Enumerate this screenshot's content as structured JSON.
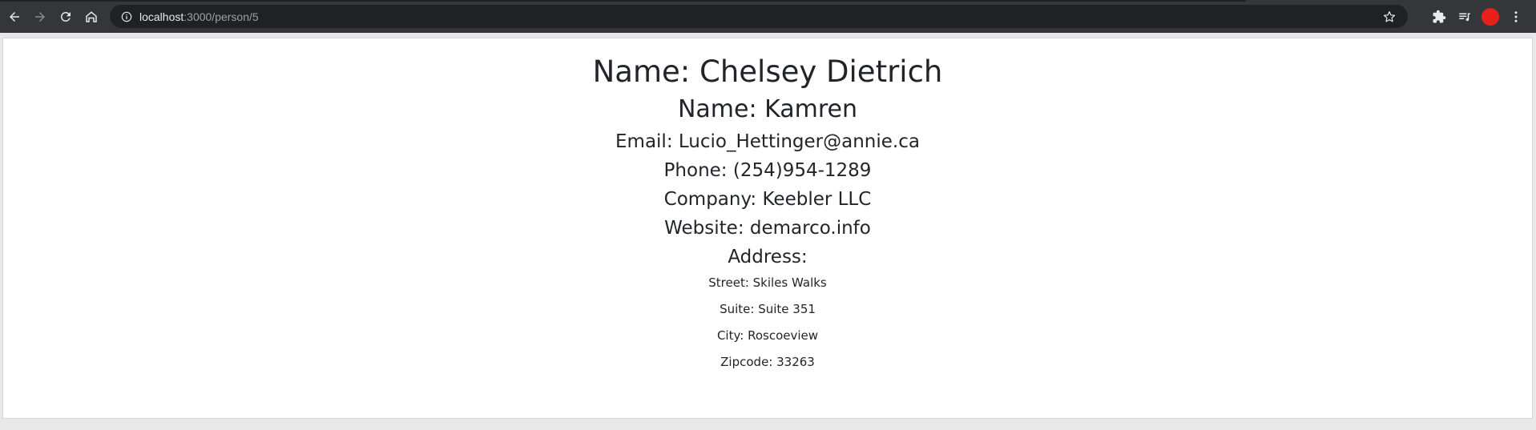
{
  "browser": {
    "url_host": "localhost",
    "url_path": ":3000/person/5",
    "icons": {
      "back": "back-arrow-icon",
      "forward": "forward-arrow-icon",
      "reload": "reload-icon",
      "home": "home-icon",
      "info": "site-info-icon",
      "bookmark": "star-icon",
      "extensions": "puzzle-icon",
      "media": "media-playlist-icon",
      "profile": "avatar",
      "menu": "kebab-menu-icon"
    },
    "colors": {
      "toolbar": "#35363a",
      "omnibox": "#202124",
      "avatar": "#e8201c"
    }
  },
  "person": {
    "name_line": "Name: Chelsey Dietrich",
    "username_line": "Name: Kamren",
    "email_line": "Email: Lucio_Hettinger@annie.ca",
    "phone_line": "Phone: (254)954-1289",
    "company_line": "Company: Keebler LLC",
    "website_line": "Website: demarco.info",
    "address_heading": "Address:",
    "street_line": "Street: Skiles Walks",
    "suite_line": "Suite: Suite 351",
    "city_line": "City: Roscoeview",
    "zipcode_line": "Zipcode: 33263"
  }
}
